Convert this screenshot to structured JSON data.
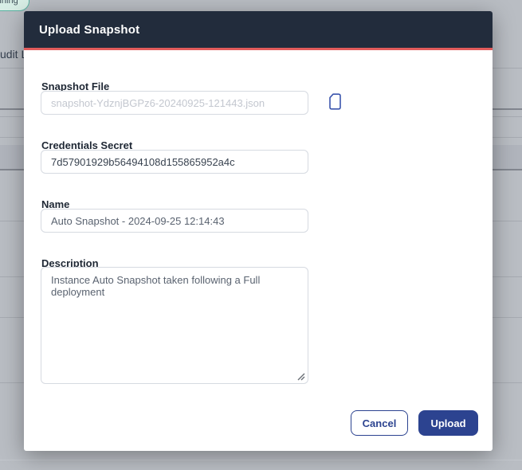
{
  "backdrop": {
    "status_badge_label": "running",
    "clipped_link_text": "udit L"
  },
  "modal": {
    "title": "Upload Snapshot",
    "snapshot_file": {
      "label": "Snapshot File",
      "placeholder": "snapshot-YdznjBGPz6-20240925-121443.json",
      "icon": "file-icon"
    },
    "credentials_secret": {
      "label": "Credentials Secret",
      "value": "7d57901929b56494108d155865952a4c"
    },
    "name": {
      "label": "Name",
      "value": "Auto Snapshot - 2024-09-25 12:14:43"
    },
    "description": {
      "label": "Description",
      "value": "Instance Auto Snapshot taken following a Full deployment"
    },
    "buttons": {
      "cancel": "Cancel",
      "upload": "Upload"
    }
  },
  "colors": {
    "header_bg": "#222c3c",
    "header_accent": "#e25b5b",
    "primary": "#2c4390",
    "backdrop": "#b9bdc3",
    "badge_border": "#5bb2a2",
    "badge_bg": "#d8eee6"
  }
}
